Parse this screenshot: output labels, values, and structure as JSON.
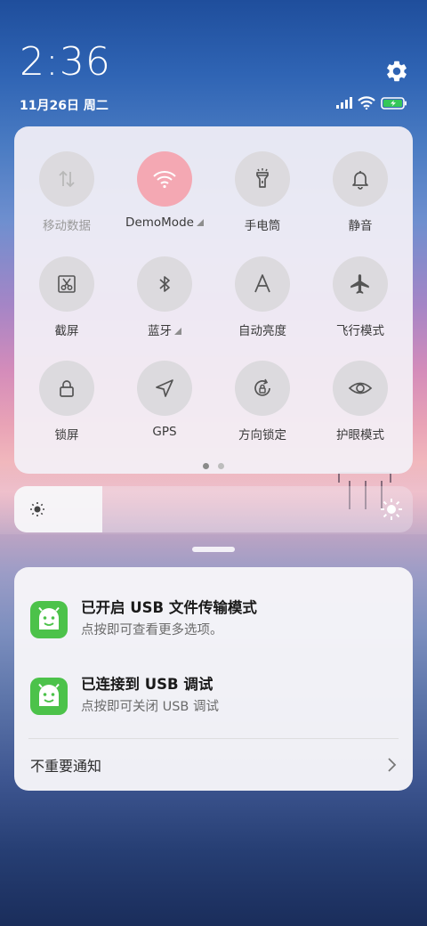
{
  "status_bar": {
    "time": "2:36",
    "date": "11月26日 周二",
    "icons": [
      "signal-icon",
      "wifi-icon",
      "battery-charging-icon"
    ],
    "battery_color": "#35c759"
  },
  "header": {
    "settings_icon": "gear-icon"
  },
  "quick_settings": {
    "active_color": "#f4a8b3",
    "tiles": [
      {
        "label": "移动数据",
        "icon": "mobile-data-icon",
        "active": false,
        "disabled": true
      },
      {
        "label": "DemoMode",
        "icon": "wifi-icon",
        "active": true,
        "has_menu": true
      },
      {
        "label": "手电筒",
        "icon": "flashlight-icon",
        "active": false
      },
      {
        "label": "静音",
        "icon": "bell-icon",
        "active": false
      },
      {
        "label": "截屏",
        "icon": "screenshot-icon",
        "active": false
      },
      {
        "label": "蓝牙",
        "icon": "bluetooth-icon",
        "active": false,
        "has_menu": true
      },
      {
        "label": "自动亮度",
        "icon": "auto-brightness-icon",
        "active": false
      },
      {
        "label": "飞行模式",
        "icon": "airplane-icon",
        "active": false
      },
      {
        "label": "锁屏",
        "icon": "lock-icon",
        "active": false
      },
      {
        "label": "GPS",
        "icon": "location-icon",
        "active": false
      },
      {
        "label": "方向锁定",
        "icon": "rotation-lock-icon",
        "active": false
      },
      {
        "label": "护眼模式",
        "icon": "eye-icon",
        "active": false
      }
    ],
    "page_count": 2,
    "current_page": 1
  },
  "brightness": {
    "level": 0.22
  },
  "notifications": {
    "items": [
      {
        "title": "已开启 USB 文件传输模式",
        "subtitle": "点按即可查看更多选项。",
        "icon": "android-usb-icon"
      },
      {
        "title": "已连接到 USB 调试",
        "subtitle": "点按即可关闭 USB 调试",
        "icon": "android-usb-icon"
      }
    ],
    "footer": "不重要通知"
  }
}
